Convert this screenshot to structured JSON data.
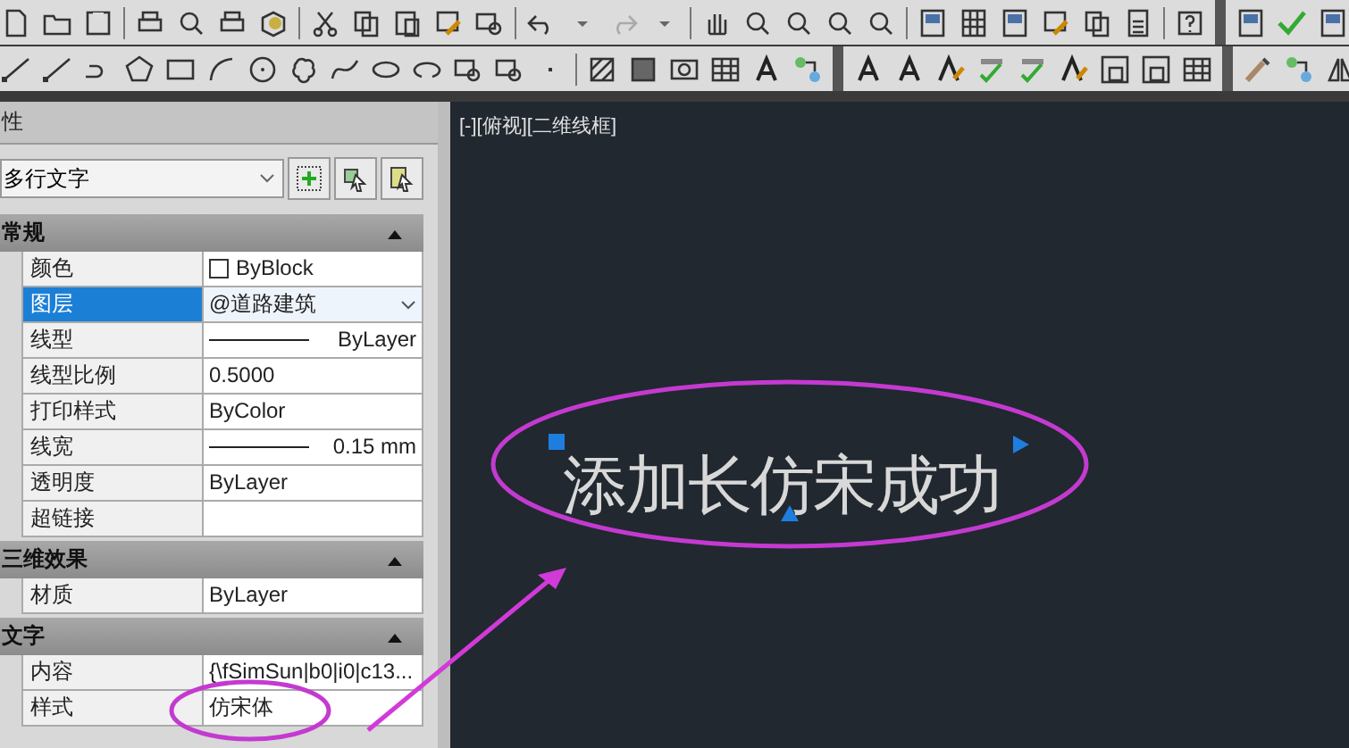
{
  "panel": {
    "title": "性",
    "object_type": "多行文字",
    "sections": [
      {
        "title": "常规",
        "expanded": true,
        "rows": [
          {
            "label": "颜色",
            "value": "ByBlock",
            "kind": "color",
            "selected": false
          },
          {
            "label": "图层",
            "value": "@道路建筑",
            "kind": "dropdown",
            "selected": true
          },
          {
            "label": "线型",
            "value": "ByLayer",
            "kind": "line",
            "selected": false
          },
          {
            "label": "线型比例",
            "value": "0.5000",
            "kind": "plain",
            "selected": false
          },
          {
            "label": "打印样式",
            "value": "ByColor",
            "kind": "plain",
            "selected": false
          },
          {
            "label": "线宽",
            "value": "0.15 mm",
            "kind": "line",
            "selected": false
          },
          {
            "label": "透明度",
            "value": "ByLayer",
            "kind": "plain",
            "selected": false
          },
          {
            "label": "超链接",
            "kind": "plain",
            "selected": false
          }
        ]
      },
      {
        "title": "三维效果",
        "expanded": true,
        "rows": [
          {
            "label": "材质",
            "value": "ByLayer",
            "kind": "plain",
            "selected": false
          }
        ]
      },
      {
        "title": "文字",
        "expanded": true,
        "rows": [
          {
            "label": "内容",
            "value": "{\\fSimSun|b0|i0|c13...",
            "kind": "plain",
            "selected": false
          },
          {
            "label": "样式",
            "value": "仿宋体",
            "kind": "plain",
            "selected": false
          }
        ]
      }
    ]
  },
  "viewport": {
    "label": "[-][俯视][二维线框]",
    "text": "添加长仿宋成功"
  }
}
